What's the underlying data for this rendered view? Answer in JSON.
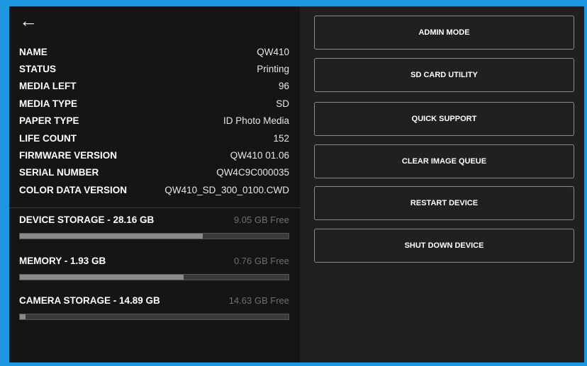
{
  "info": {
    "rows": [
      {
        "label": "NAME",
        "value": "QW410"
      },
      {
        "label": "STATUS",
        "value": "Printing"
      },
      {
        "label": "MEDIA LEFT",
        "value": "96"
      },
      {
        "label": "MEDIA TYPE",
        "value": "SD"
      },
      {
        "label": "PAPER TYPE",
        "value": "ID Photo Media"
      },
      {
        "label": "LIFE COUNT",
        "value": "152"
      },
      {
        "label": "FIRMWARE VERSION",
        "value": "QW410 01.06"
      },
      {
        "label": "SERIAL NUMBER",
        "value": "QW4C9C000035"
      },
      {
        "label": "COLOR DATA VERSION",
        "value": "QW410_SD_300_0100.CWD"
      }
    ]
  },
  "storage": [
    {
      "title": "DEVICE STORAGE - 28.16 GB",
      "free": "9.05 GB Free",
      "used_fraction": 0.68
    },
    {
      "title": "MEMORY - 1.93 GB",
      "free": "0.76 GB Free",
      "used_fraction": 0.61
    },
    {
      "title": "CAMERA STORAGE - 14.89 GB",
      "free": "14.63 GB Free",
      "used_fraction": 0.02
    }
  ],
  "actions": {
    "admin_mode": "ADMIN MODE",
    "sd_card_utility": "SD CARD UTILITY",
    "quick_support": "QUICK SUPPORT",
    "clear_image_queue": "CLEAR IMAGE QUEUE",
    "restart_device": "RESTART DEVICE",
    "shut_down_device": "SHUT DOWN DEVICE"
  },
  "icons": {
    "back": "arrow-left-icon"
  },
  "colors": {
    "accent": "#1c97e0",
    "panel_left": "#151515",
    "panel_right": "#202020"
  }
}
